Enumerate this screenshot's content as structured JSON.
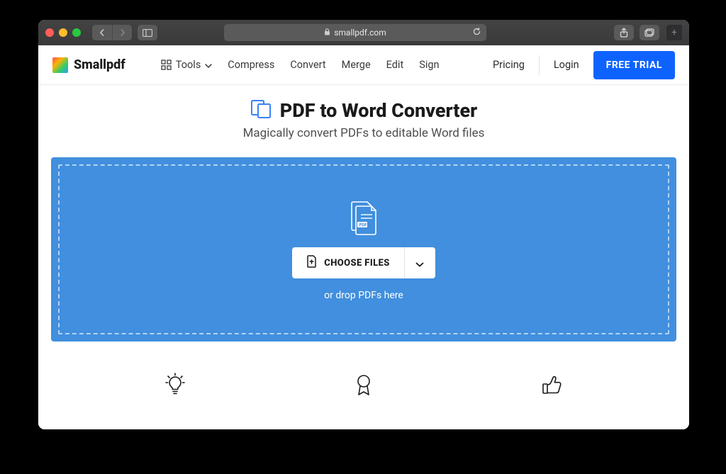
{
  "browser": {
    "url_host": "smallpdf.com"
  },
  "header": {
    "logo_text": "Smallpdf",
    "nav": {
      "tools": "Tools",
      "compress": "Compress",
      "convert": "Convert",
      "merge": "Merge",
      "edit": "Edit",
      "sign": "Sign"
    },
    "pricing": "Pricing",
    "login": "Login",
    "free_trial": "FREE TRIAL"
  },
  "hero": {
    "title": "PDF to Word Converter",
    "subtitle": "Magically convert PDFs to editable Word files"
  },
  "dropzone": {
    "choose_label": "CHOOSE FILES",
    "hint": "or drop PDFs here"
  }
}
